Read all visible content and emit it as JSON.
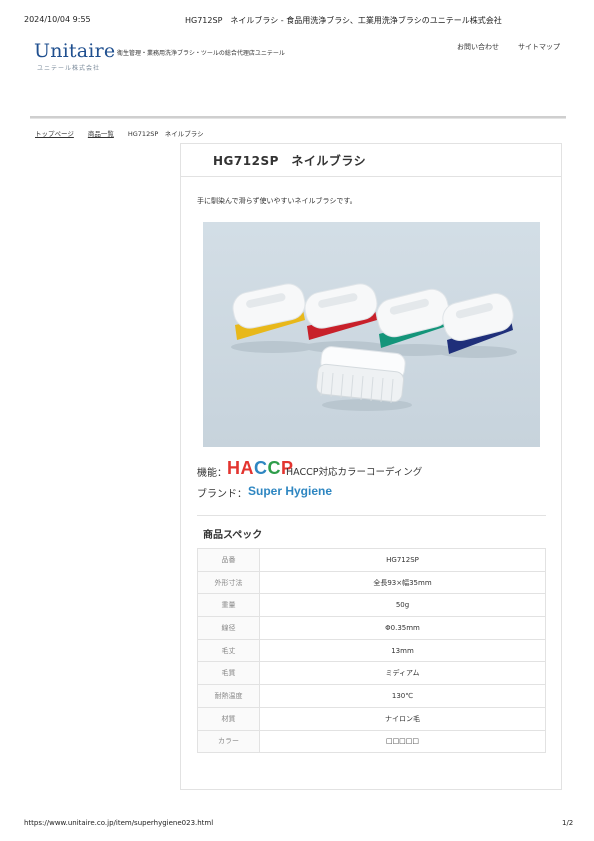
{
  "print_header": {
    "datetime": "2024/10/04 9:55",
    "title": "HG712SP　ネイルブラシ - 食品用洗浄ブラシ、工業用洗浄ブラシのユニテール株式会社"
  },
  "site": {
    "logo": "Unitaire",
    "logo_sub": "ユニテール株式会社",
    "tagline": "衛生管理・業務用洗浄ブラシ・ツールの総合代理店ユニテール",
    "nav": {
      "contact": "お問い合わせ",
      "sitemap": "サイトマップ"
    }
  },
  "breadcrumb": {
    "home": "トップページ",
    "list": "商品一覧",
    "current": "HG712SP　ネイルブラシ"
  },
  "product": {
    "title": "HG712SP　ネイルブラシ",
    "description": "手に馴染んで滑らず使いやすいネイルブラシです。",
    "function_label": "機能：",
    "haccp_logo": "HACCP",
    "function_text": "HACCP対応カラーコーディング",
    "brand_label": "ブランド：",
    "brand_value": "Super Hygiene"
  },
  "spec": {
    "title": "商品スペック",
    "rows": [
      {
        "key": "品番",
        "value": "HG712SP"
      },
      {
        "key": "外形寸法",
        "value": "全長93×幅35mm"
      },
      {
        "key": "重量",
        "value": "50g"
      },
      {
        "key": "線径",
        "value": "Φ0.35mm"
      },
      {
        "key": "毛丈",
        "value": "13mm"
      },
      {
        "key": "毛質",
        "value": "ミディアム"
      },
      {
        "key": "耐熱温度",
        "value": "130℃"
      },
      {
        "key": "材質",
        "value": "ナイロン毛"
      },
      {
        "key": "カラー",
        "value": "□□□□□"
      }
    ]
  },
  "colors": {
    "haccp": [
      "#e3342f",
      "#e3342f",
      "#2e86c1",
      "#2e9d4a",
      "#e3342f"
    ],
    "bristles": [
      "#e8b81a",
      "#c8202a",
      "#14957a",
      "#1f2f7a",
      "#f2f4f6"
    ],
    "brand": "#2e86c1",
    "logo": "#1f4f8f"
  },
  "footer": {
    "url": "https://www.unitaire.co.jp/item/superhygiene023.html",
    "page": "1/2"
  }
}
